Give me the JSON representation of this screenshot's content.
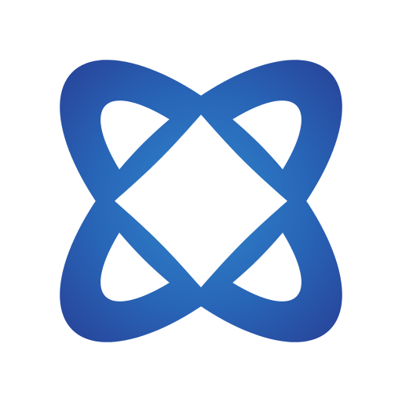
{
  "logo": {
    "icon": "orbit-logo-icon",
    "colors": {
      "background": "#ffffff",
      "center": "#2f86cc",
      "mid": "#2864b6",
      "edge": "#273f95"
    }
  }
}
